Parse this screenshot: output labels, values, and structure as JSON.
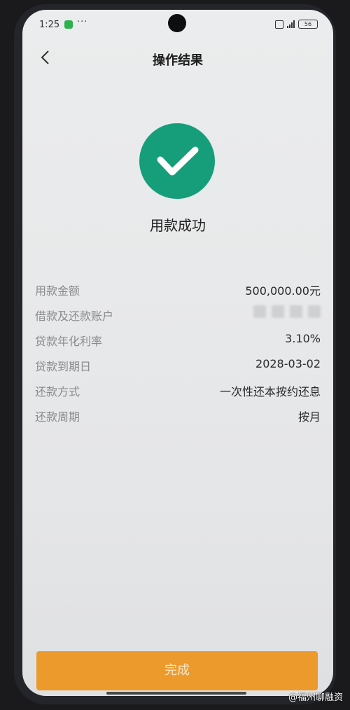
{
  "status_bar": {
    "time": "1:25",
    "dots": "···",
    "battery": "56"
  },
  "nav": {
    "title": "操作结果"
  },
  "result": {
    "message": "用款成功"
  },
  "details": [
    {
      "label": "用款金额",
      "value": "500,000.00元"
    },
    {
      "label": "借款及还款账户",
      "value": ""
    },
    {
      "label": "贷款年化利率",
      "value": "3.10%"
    },
    {
      "label": "贷款到期日",
      "value": "2028-03-02"
    },
    {
      "label": "还款方式",
      "value": "一次性还本按约还息"
    },
    {
      "label": "还款周期",
      "value": "按月"
    }
  ],
  "button": {
    "done_label": "完成"
  },
  "watermark": "@福州聊融资",
  "colors": {
    "success": "#169e7a",
    "button": "#ec9a2c"
  }
}
